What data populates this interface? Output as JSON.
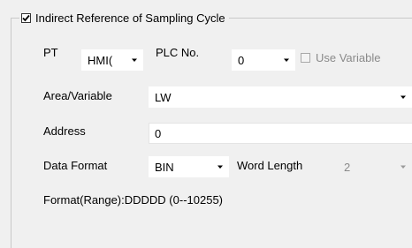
{
  "group": {
    "title": "Indirect Reference of Sampling Cycle",
    "checked": true
  },
  "pt": {
    "label": "PT",
    "value": "HMI",
    "value_visible": "HMI("
  },
  "plc_no": {
    "label": "PLC No.",
    "value": "0"
  },
  "use_variable": {
    "label": "Use Variable",
    "checked": false,
    "disabled": true
  },
  "area_variable": {
    "label": "Area/Variable",
    "value": "LW"
  },
  "address": {
    "label": "Address",
    "value": "0"
  },
  "data_format": {
    "label": "Data Format",
    "value": "BIN"
  },
  "word_length": {
    "label": "Word Length",
    "value": "2",
    "disabled": true
  },
  "format_range": {
    "text": "Format(Range):DDDDD (0--10255)"
  },
  "icons": {
    "checkbox_checked": "checkmark-icon",
    "dropdown": "dropdown-arrow-icon"
  }
}
